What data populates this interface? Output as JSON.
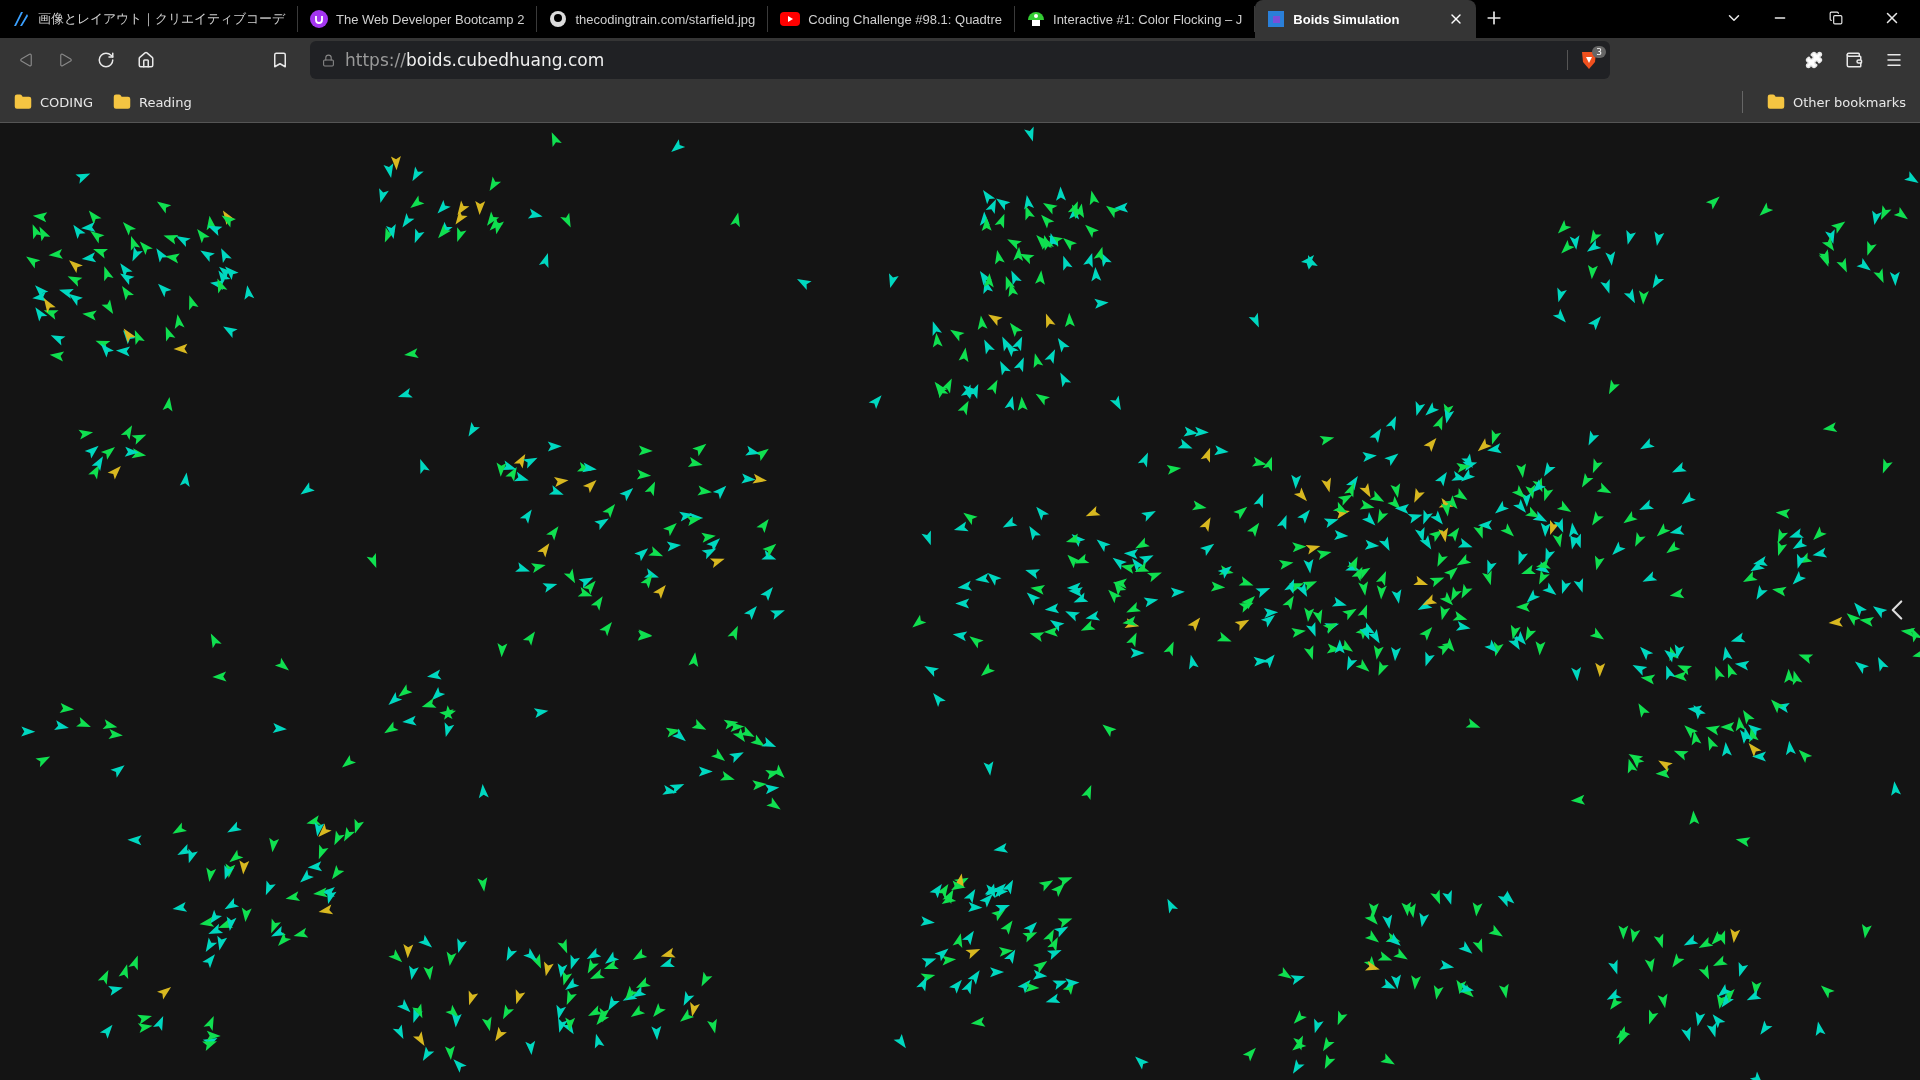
{
  "tabs": [
    {
      "title": "画像とレイアウト｜クリエイティブコーデ",
      "selected": false
    },
    {
      "title": "The Web Developer Bootcamp 2",
      "selected": false
    },
    {
      "title": "thecodingtrain.com/starfield.jpg",
      "selected": false
    },
    {
      "title": "Coding Challenge #98.1: Quadtre",
      "selected": false
    },
    {
      "title": "Interactive #1: Color Flocking – J",
      "selected": false
    },
    {
      "title": "Boids Simulation",
      "selected": true
    }
  ],
  "address_bar": {
    "scheme": "https://",
    "host": "boids.cubedhuang.com",
    "shield_count": "3"
  },
  "bookmarks": [
    {
      "label": "CODING"
    },
    {
      "label": "Reading"
    }
  ],
  "other_bookmarks": "Other bookmarks"
}
